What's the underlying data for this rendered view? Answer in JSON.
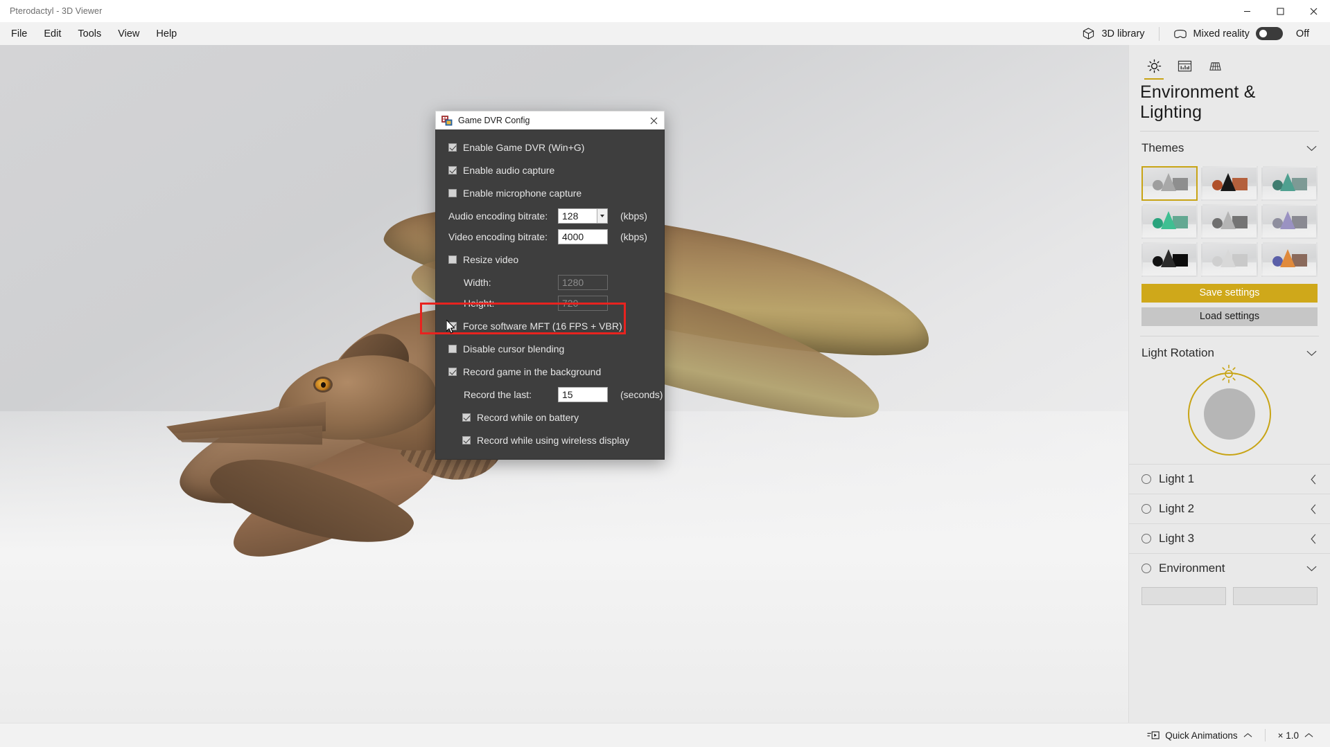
{
  "window": {
    "title": "Pterodactyl - 3D Viewer",
    "controls": {
      "minimize": "minimize-icon",
      "maximize": "maximize-icon",
      "close": "close-icon"
    }
  },
  "menubar": {
    "items": [
      "File",
      "Edit",
      "Tools",
      "View",
      "Help"
    ],
    "library_label": "3D library",
    "library_icon": "cube-icon",
    "mixed_reality_label": "Mixed reality",
    "mixed_reality_icon": "headset-icon",
    "mixed_reality_state": "Off"
  },
  "right_panel": {
    "tabs": [
      {
        "name": "environment-lighting",
        "icon": "sun-icon",
        "active": true
      },
      {
        "name": "effects",
        "icon": "chart-icon",
        "active": false
      },
      {
        "name": "grid",
        "icon": "grid-icon",
        "active": false
      }
    ],
    "title": "Environment & Lighting",
    "themes": {
      "section_label": "Themes",
      "chevron": "chevron-down-icon",
      "selected_index": 0,
      "swatches": [
        {
          "name": "gray",
          "sphere": "#9e9e9e",
          "cone": "#a8a8a8",
          "cube": "#8e8e8e"
        },
        {
          "name": "dark-orange",
          "sphere": "#b0502a",
          "cone": "#181818",
          "cube": "#b4603c"
        },
        {
          "name": "teal",
          "sphere": "#3f7d70",
          "cone": "#4fa090",
          "cube": "#7d9a95"
        },
        {
          "name": "green",
          "sphere": "#2aa37d",
          "cone": "#3fbf92",
          "cube": "#63a892"
        },
        {
          "name": "neutral",
          "sphere": "#6f6f6f",
          "cone": "#b4b4b4",
          "cube": "#747474"
        },
        {
          "name": "violet",
          "sphere": "#8e8e9e",
          "cone": "#9a92c2",
          "cube": "#8a8a92"
        },
        {
          "name": "black",
          "sphere": "#121212",
          "cone": "#2b2b2b",
          "cube": "#0c0c0c"
        },
        {
          "name": "white",
          "sphere": "#cfcfcf",
          "cone": "#d8d8d8",
          "cube": "#c9c9c9"
        },
        {
          "name": "sunset",
          "sphere": "#5a5fa8",
          "cone": "#e08a3c",
          "cube": "#8a6a5c"
        }
      ],
      "save_label": "Save settings",
      "load_label": "Load settings",
      "accent_color": "#cfa81a"
    },
    "light_rotation": {
      "section_label": "Light Rotation",
      "chevron": "chevron-down-icon",
      "sun_icon": "sun-icon",
      "ring_color": "#c8a415"
    },
    "lights": [
      {
        "label": "Light 1",
        "radio": "radio-off",
        "caret": "chevron-left-icon"
      },
      {
        "label": "Light 2",
        "radio": "radio-off",
        "caret": "chevron-left-icon"
      },
      {
        "label": "Light 3",
        "radio": "radio-off",
        "caret": "chevron-left-icon"
      },
      {
        "label": "Environment",
        "radio": "radio-off",
        "caret": "chevron-down-icon"
      }
    ]
  },
  "bottombar": {
    "quick_animations_label": "Quick Animations",
    "quick_animations_icon": "animation-icon",
    "quick_animations_chevron": "chevron-up-icon",
    "zoom_label": "× 1.0",
    "zoom_chevron": "chevron-up-icon"
  },
  "dialog": {
    "title": "Game DVR Config",
    "icon": "app-window-icon",
    "close_icon": "close-icon",
    "rows": {
      "enable_game_dvr": {
        "label": "Enable Game DVR (Win+G)",
        "checked": true
      },
      "enable_audio_capture": {
        "label": "Enable audio capture",
        "checked": true
      },
      "enable_microphone_capture": {
        "label": "Enable microphone capture",
        "checked": false
      },
      "audio_bitrate": {
        "label": "Audio encoding bitrate:",
        "value": "128",
        "unit": "(kbps)"
      },
      "video_bitrate": {
        "label": "Video encoding bitrate:",
        "value": "4000",
        "unit": "(kbps)"
      },
      "resize_video": {
        "label": "Resize video",
        "checked": false
      },
      "width": {
        "label": "Width:",
        "value": "1280",
        "disabled": true
      },
      "height": {
        "label": "Height:",
        "value": "720",
        "disabled": true
      },
      "force_software_mft": {
        "label": "Force software MFT (16 FPS + VBR)",
        "checked": true,
        "highlighted": true
      },
      "disable_cursor_blending": {
        "label": "Disable cursor blending",
        "checked": false
      },
      "record_background": {
        "label": "Record game in the background",
        "checked": true
      },
      "record_last": {
        "label": "Record the last:",
        "value": "15",
        "unit": "(seconds)"
      },
      "record_on_battery": {
        "label": "Record while on battery",
        "checked": true
      },
      "record_wireless": {
        "label": "Record while using wireless display",
        "checked": true
      }
    },
    "highlight_color": "#e8231f"
  }
}
